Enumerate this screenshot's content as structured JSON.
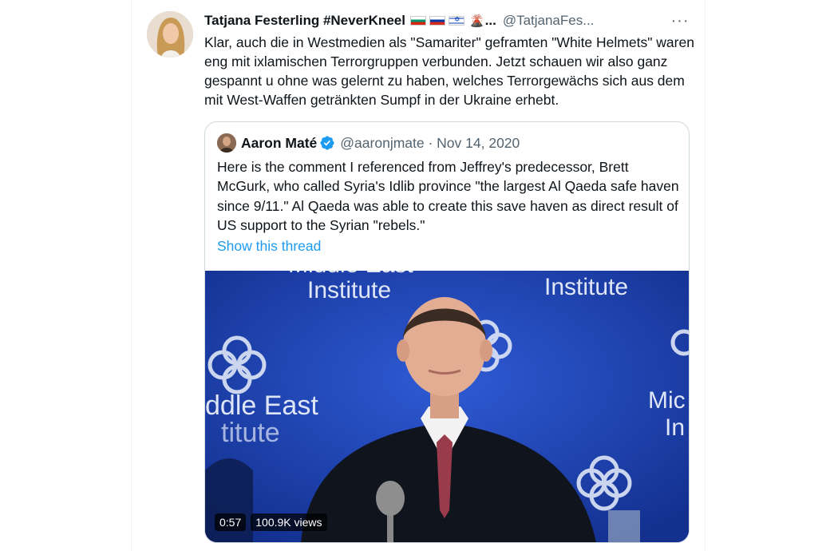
{
  "tweet": {
    "author_name": "Tatjana Festerling #NeverKneel",
    "name_ellipsis": "...",
    "handle": "@TatjanaFes...",
    "more_icon": "more-horizontal-icon",
    "text": "Klar, auch die in Westmedien als \"Samariter\" geframten \"White Helmets\" waren eng mit ixlamischen Terrorgruppen verbunden. Jetzt schauen wir also ganz gespannt u ohne was gelernt zu haben, welches Terrorgewächs sich aus dem mit West-Waffen getränkten Sumpf in der Ukraine erhebt."
  },
  "quote": {
    "author_name": "Aaron Maté",
    "handle_date": "@aaronjmate · Nov 14, 2020",
    "text": "Here is the comment I referenced from Jeffrey's predecessor, Brett McGurk, who called Syria's Idlib province \"the largest Al Qaeda safe haven since 9/11.\" Al Qaeda was able to create this save haven as direct result  of US support to the Syrian \"rebels.\"",
    "show_thread": "Show this thread",
    "verified_color": "#1d9bf0"
  },
  "video": {
    "duration": "0:57",
    "views": "100.9K views",
    "backdrop_texts": [
      "Middle East",
      "Institute",
      "Institute",
      "ddle East",
      "titute",
      "Mic",
      "In"
    ]
  },
  "colors": {
    "link": "#1d9bf0",
    "secondary_text": "#536471",
    "border": "#cfd9de",
    "backdrop_blue": "#1a3fb0"
  }
}
